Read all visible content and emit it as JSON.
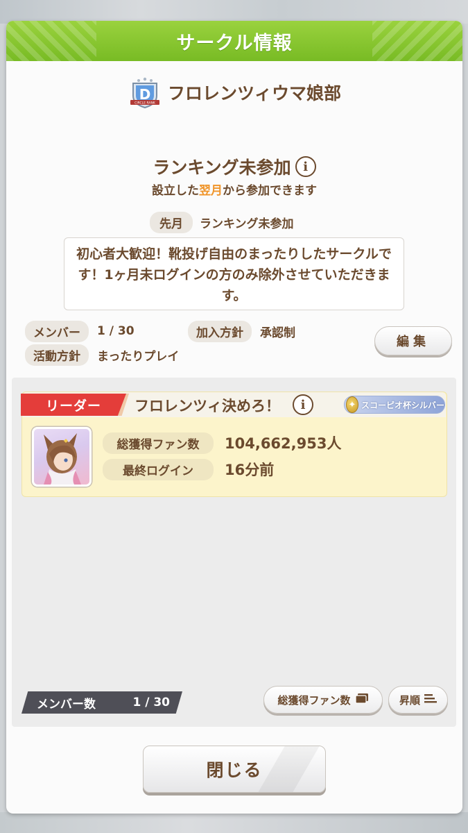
{
  "dialog": {
    "title": "サークル情報",
    "header_color": "#84c22c"
  },
  "circle": {
    "rank_badge_letter": "D",
    "rank_badge_ribbon": "CIRCLE RANK",
    "name": "フロレンツィウマ娘部",
    "ranking_status": "ランキング未参加",
    "ranking_note_prefix": "設立した",
    "ranking_note_highlight": "翌月",
    "ranking_note_suffix": "から参加できます",
    "last_month_label": "先月",
    "last_month_value": "ランキング未参加",
    "description": "初心者大歓迎！靴投げ自由のまったりしたサークルです！1ヶ月未ログインの方のみ除外させていただきます。",
    "members_label": "メンバー",
    "members_value": "1 / 30",
    "join_policy_label": "加入方針",
    "join_policy_value": "承認制",
    "activity_label": "活動方針",
    "activity_value": "まったりプレイ",
    "edit_button": "編集"
  },
  "leader": {
    "tag": "リーダー",
    "name": "フロレンツィ決めろ！",
    "title_badge": "スコーピオ杯シルバー",
    "fans_label": "総獲得ファン数",
    "fans_value": "104,662,953人",
    "last_login_label": "最終ログイン",
    "last_login_value": "16分前"
  },
  "footer": {
    "member_count_label": "メンバー数",
    "member_count_value": "1 / 30",
    "sort_key_button": "総獲得ファン数",
    "sort_order_button": "昇順",
    "close_button": "閉じる"
  },
  "colors": {
    "text_brown": "#6b4a2e",
    "accent_orange": "#f0952a",
    "leader_red": "#e43d3a",
    "card_yellow": "#fcf4cb"
  }
}
